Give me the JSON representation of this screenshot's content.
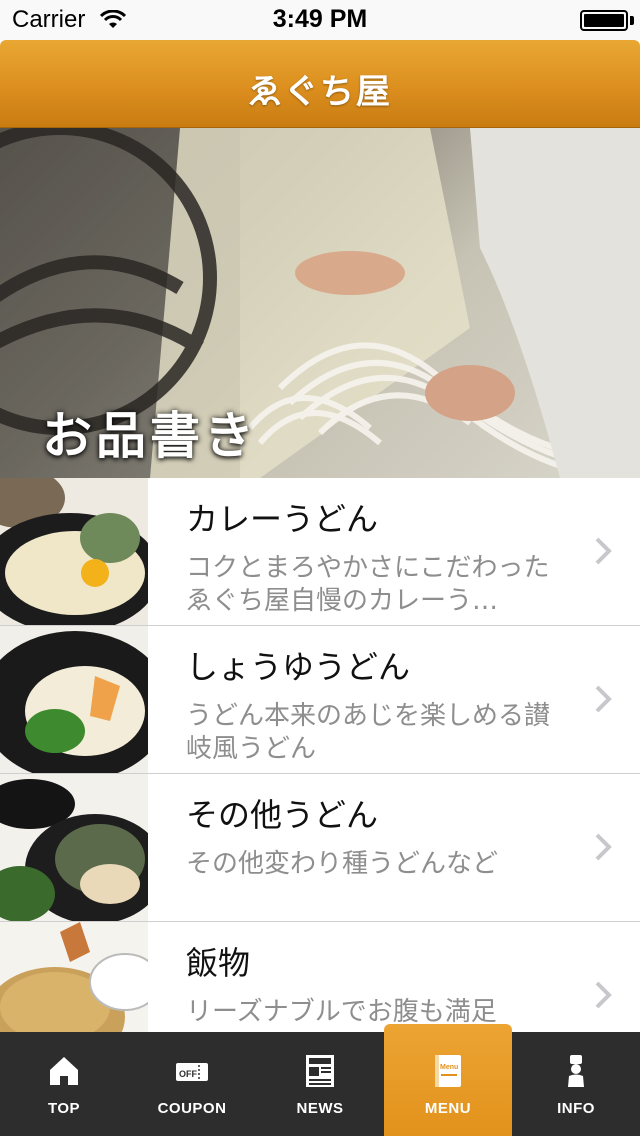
{
  "status_bar": {
    "carrier": "Carrier",
    "time": "3:49 PM"
  },
  "nav": {
    "title": "ゑぐち屋"
  },
  "hero": {
    "title": "お品書き"
  },
  "menu": {
    "items": [
      {
        "title": "カレーうどん",
        "description": "コクとまろやかさにこだわったゑぐち屋自慢のカレーう…"
      },
      {
        "title": "しょうゆうどん",
        "description": "うどん本来のあじを楽しめる讃岐風うどん"
      },
      {
        "title": "その他うどん",
        "description": "その他変わり種うどんなど"
      },
      {
        "title": "飯物",
        "description": "リーズナブルでお腹も満足"
      }
    ]
  },
  "tabs": [
    {
      "label": "TOP",
      "icon": "home-icon"
    },
    {
      "label": "COUPON",
      "icon": "coupon-icon"
    },
    {
      "label": "NEWS",
      "icon": "newspaper-icon"
    },
    {
      "label": "MENU",
      "icon": "menu-book-icon",
      "active": true
    },
    {
      "label": "INFO",
      "icon": "chef-icon"
    }
  ],
  "colors": {
    "accent": "#e2921c",
    "nav_top": "#e9a733",
    "tab_bar": "#2d2d2d",
    "text_secondary": "#8e8e8e"
  }
}
